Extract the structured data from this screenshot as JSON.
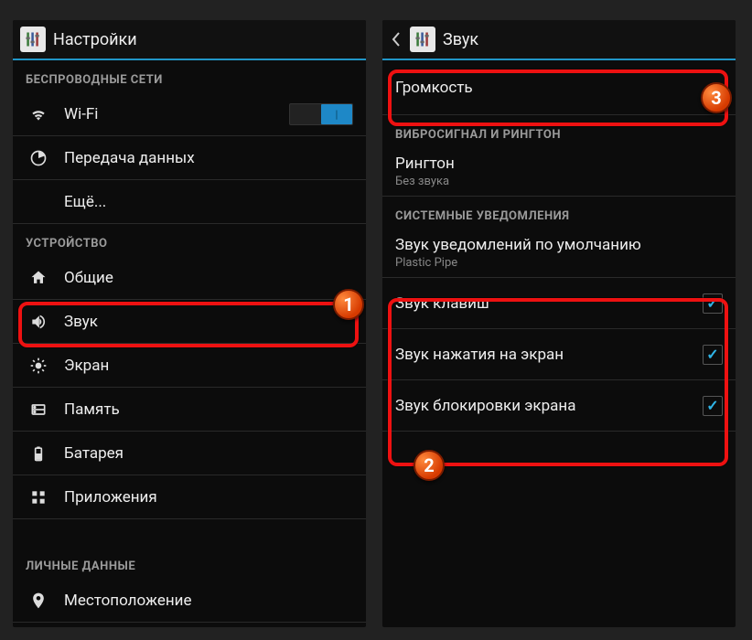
{
  "left": {
    "title": "Настройки",
    "section_wireless": "БЕСПРОВОДНЫЕ СЕТИ",
    "wifi": "Wi-Fi",
    "data": "Передача данных",
    "more": "Ещё...",
    "section_device": "УСТРОЙСТВО",
    "general": "Общие",
    "sound": "Звук",
    "display": "Экран",
    "storage": "Память",
    "battery": "Батарея",
    "apps": "Приложения",
    "section_personal": "ЛИЧНЫЕ ДАННЫЕ",
    "location": "Местоположение"
  },
  "right": {
    "title": "Звук",
    "volume": "Громкость",
    "section_vibro": "ВИБРОСИГНАЛ И РИНГТОН",
    "ringtone": "Рингтон",
    "ringtone_sub": "Без звука",
    "section_system": "СИСТЕМНЫЕ УВЕДОМЛЕНИЯ",
    "notif_sound": "Звук уведомлений по умолчанию",
    "notif_sound_sub": "Plastic Pipe",
    "key_sounds": "Звук клавиш",
    "touch_sounds": "Звук нажатия на экран",
    "lock_sound": "Звук блокировки экрана"
  },
  "badges": {
    "b1": "1",
    "b2": "2",
    "b3": "3"
  }
}
